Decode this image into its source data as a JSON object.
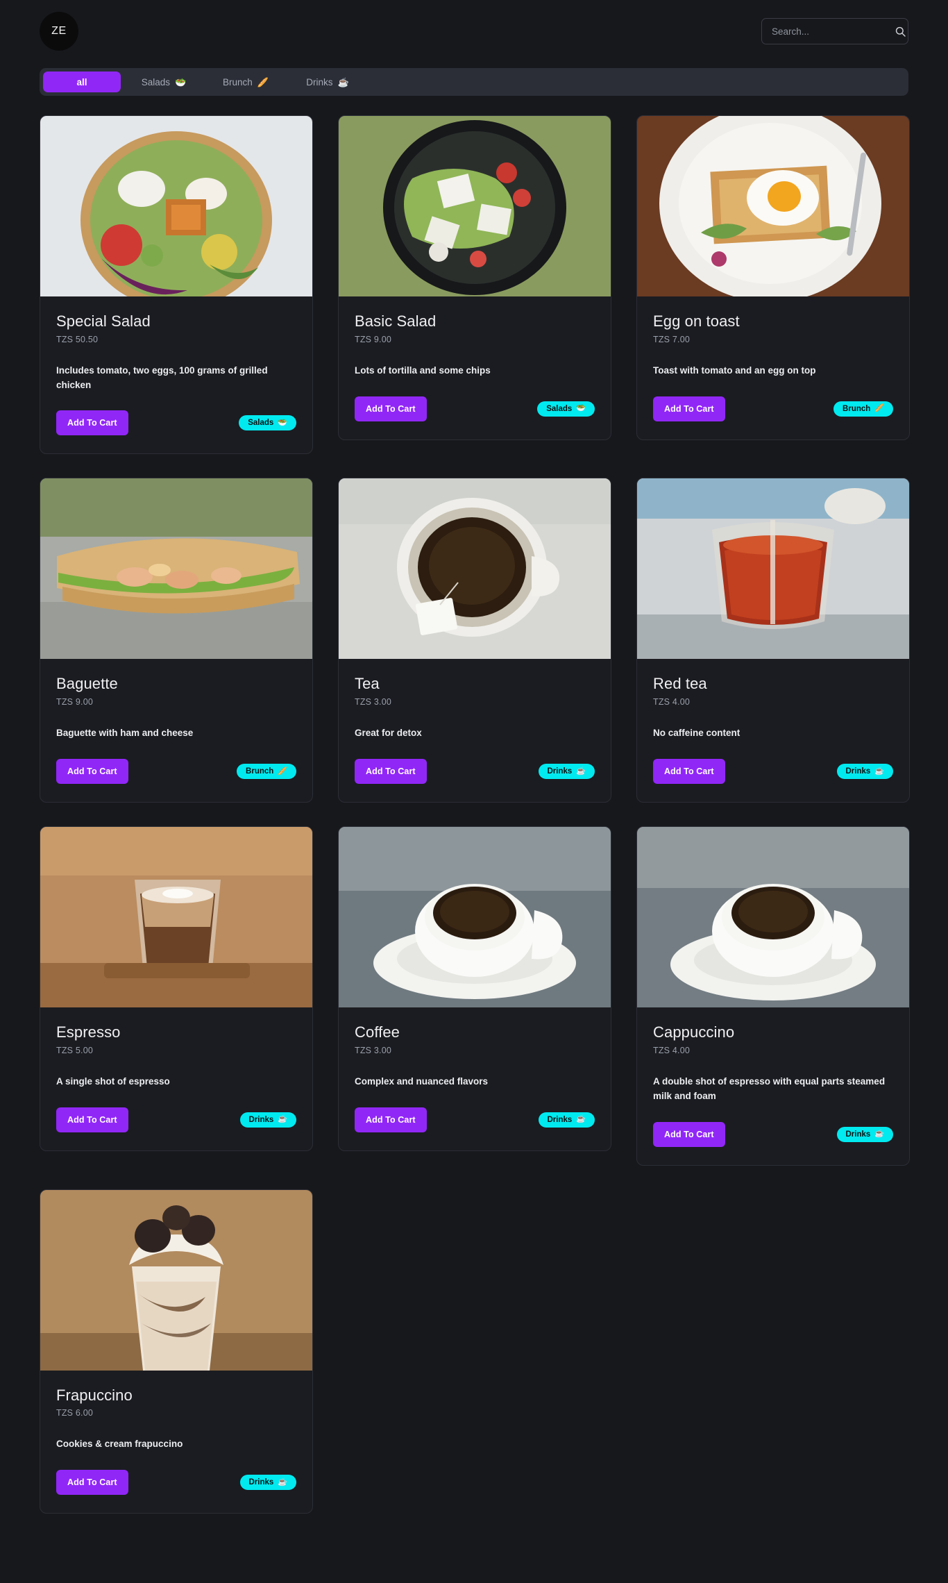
{
  "header": {
    "logo_text": "ZE",
    "search_placeholder": "Search...",
    "search_value": "",
    "search_icon": "search-icon"
  },
  "filters": [
    {
      "label": "all",
      "emoji": "",
      "active": true
    },
    {
      "label": "Salads",
      "emoji": "🥗",
      "active": false
    },
    {
      "label": "Brunch",
      "emoji": "🥖",
      "active": false
    },
    {
      "label": "Drinks",
      "emoji": "☕",
      "active": false
    }
  ],
  "labels": {
    "add_to_cart": "Add To Cart",
    "currency": "TZS"
  },
  "colors": {
    "background": "#17181c",
    "card": "#1b1c21",
    "accent_purple": "#9127f7",
    "badge_cyan": "#00eaf0",
    "filterbar": "#2b2e37",
    "title": "#f0f0f2",
    "price": "#9aa0ab"
  },
  "items": [
    {
      "title": "Special Salad",
      "price": "TZS 50.50",
      "description": "Includes tomato, two eggs, 100 grams of grilled chicken",
      "button": "Add To Cart",
      "category": "Salads",
      "category_emoji": "🥗",
      "photo": "salad-bowl-photo"
    },
    {
      "title": "Basic Salad",
      "price": "TZS 9.00",
      "description": "Lots of tortilla and some chips",
      "button": "Add To Cart",
      "category": "Salads",
      "category_emoji": "🥗",
      "photo": "green-salad-plate-photo"
    },
    {
      "title": "Egg on toast",
      "price": "TZS 7.00",
      "description": "Toast with tomato and an egg on top",
      "button": "Add To Cart",
      "category": "Brunch",
      "category_emoji": "🥖",
      "photo": "egg-toast-photo"
    },
    {
      "title": "Baguette",
      "price": "TZS 9.00",
      "description": "Baguette with ham and cheese",
      "button": "Add To Cart",
      "category": "Brunch",
      "category_emoji": "🥖",
      "photo": "baguette-sandwich-photo"
    },
    {
      "title": "Tea",
      "price": "TZS 3.00",
      "description": "Great for detox",
      "button": "Add To Cart",
      "category": "Drinks",
      "category_emoji": "☕",
      "photo": "tea-cup-photo"
    },
    {
      "title": "Red tea",
      "price": "TZS 4.00",
      "description": "No caffeine content",
      "button": "Add To Cart",
      "category": "Drinks",
      "category_emoji": "☕",
      "photo": "red-tea-glass-photo"
    },
    {
      "title": "Espresso",
      "price": "TZS 5.00",
      "description": "A single shot of espresso",
      "button": "Add To Cart",
      "category": "Drinks",
      "category_emoji": "☕",
      "photo": "espresso-glass-photo"
    },
    {
      "title": "Coffee",
      "price": "TZS 3.00",
      "description": "Complex and nuanced flavors",
      "button": "Add To Cart",
      "category": "Drinks",
      "category_emoji": "☕",
      "photo": "coffee-cup-photo"
    },
    {
      "title": "Cappuccino",
      "price": "TZS 4.00",
      "description": "A double shot of espresso with equal parts steamed milk and foam",
      "button": "Add To Cart",
      "category": "Drinks",
      "category_emoji": "☕",
      "photo": "cappuccino-cup-photo"
    },
    {
      "title": "Frapuccino",
      "price": "TZS 6.00",
      "description": "Cookies & cream frapuccino",
      "button": "Add To Cart",
      "category": "Drinks",
      "category_emoji": "☕",
      "photo": "frapuccino-glass-photo"
    }
  ]
}
